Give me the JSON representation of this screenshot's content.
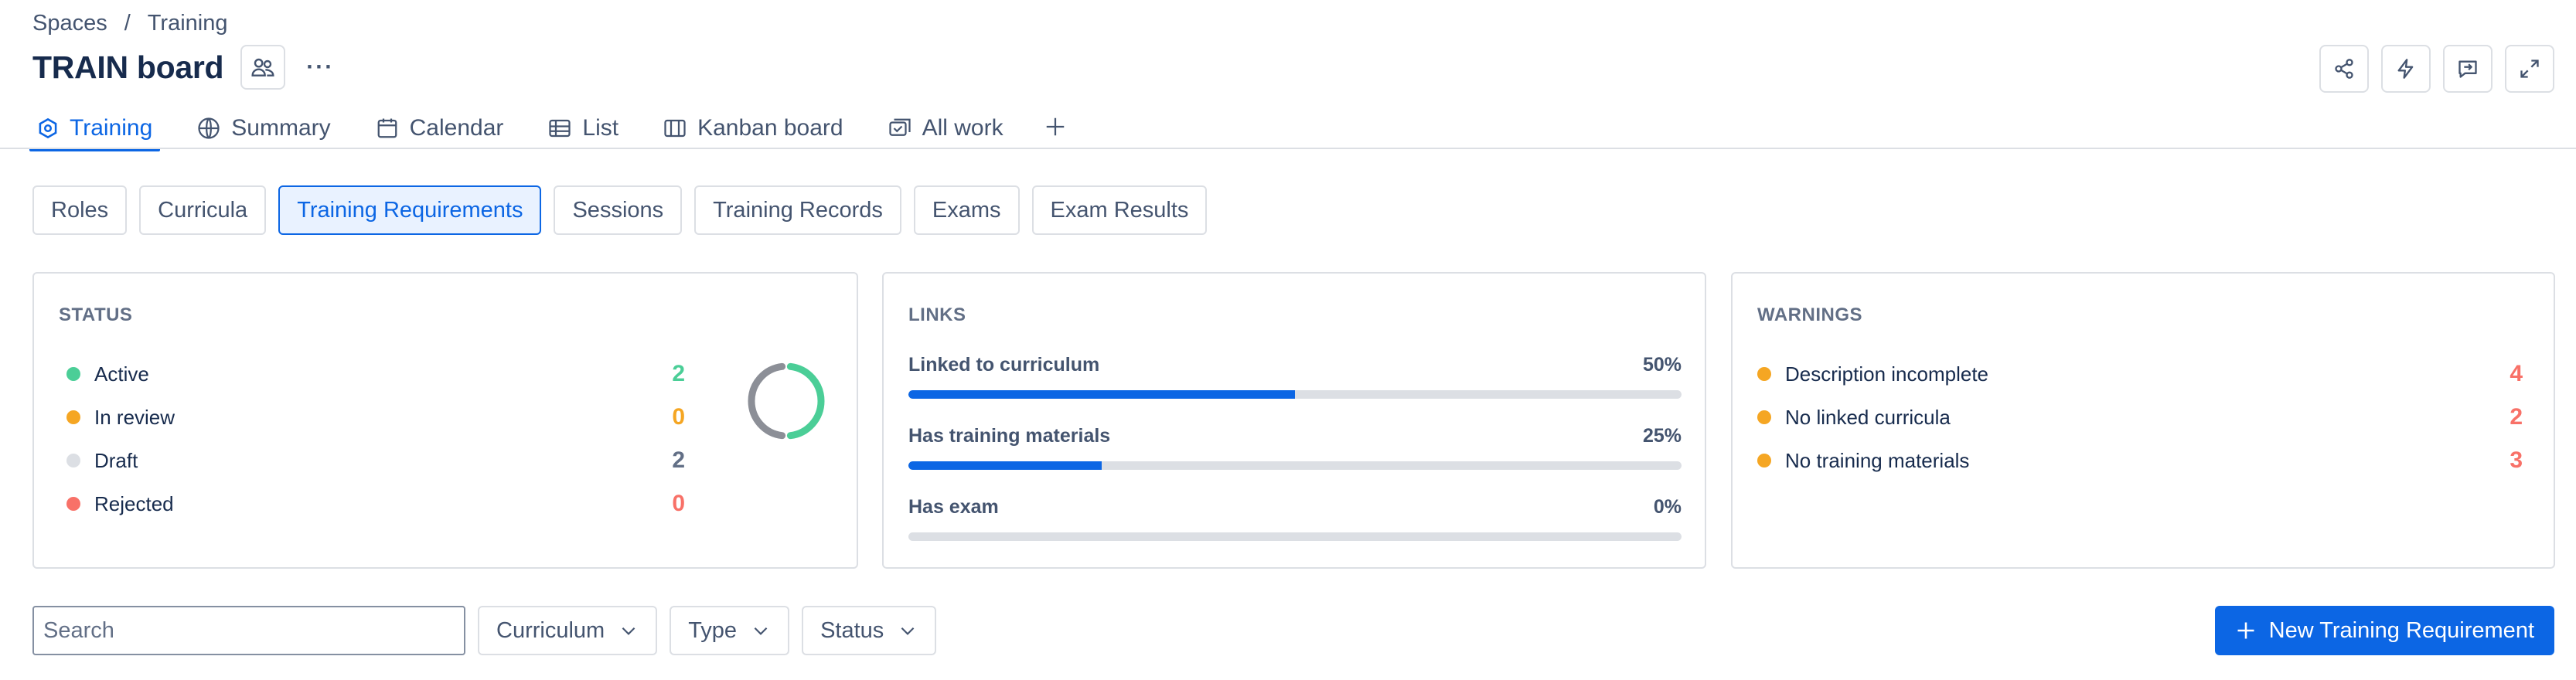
{
  "breadcrumb": {
    "root": "Spaces",
    "separator": "/",
    "current": "Training"
  },
  "header": {
    "title": "TRAIN board",
    "more": "···"
  },
  "tabs": [
    {
      "label": "Training",
      "icon": "training-hex-icon",
      "active": true
    },
    {
      "label": "Summary",
      "icon": "globe-icon"
    },
    {
      "label": "Calendar",
      "icon": "calendar-icon"
    },
    {
      "label": "List",
      "icon": "list-table-icon"
    },
    {
      "label": "Kanban board",
      "icon": "board-icon"
    },
    {
      "label": "All work",
      "icon": "all-work-icon"
    }
  ],
  "subnav": {
    "items": [
      "Roles",
      "Curricula",
      "Training Requirements",
      "Sessions",
      "Training Records",
      "Exams",
      "Exam Results"
    ],
    "active": "Training Requirements"
  },
  "status_card": {
    "title": "STATUS",
    "rows": [
      {
        "label": "Active",
        "count": "2",
        "color": "#4bce97"
      },
      {
        "label": "In review",
        "count": "0",
        "color": "#f5a623"
      },
      {
        "label": "Draft",
        "count": "2",
        "color": "#dcdfe4"
      },
      {
        "label": "Rejected",
        "count": "0",
        "color": "#f87168"
      }
    ],
    "count_colors": [
      "#4bce97",
      "#f5a623",
      "#626f86",
      "#f87168"
    ],
    "donut": {
      "active": 2,
      "draft": 2,
      "active_color": "#4bce97",
      "draft_color": "#8c8f97"
    }
  },
  "links_card": {
    "title": "LINKS",
    "items": [
      {
        "label": "Linked to curriculum",
        "percent": "50%",
        "value": 0.5
      },
      {
        "label": "Has training materials",
        "percent": "25%",
        "value": 0.25
      },
      {
        "label": "Has exam",
        "percent": "0%",
        "value": 0
      }
    ]
  },
  "warnings_card": {
    "title": "WARNINGS",
    "rows": [
      {
        "label": "Description incomplete",
        "count": "4"
      },
      {
        "label": "No linked curricula",
        "count": "2"
      },
      {
        "label": "No training materials",
        "count": "3"
      }
    ],
    "dot_color": "#f5a623",
    "count_color": "#f87168"
  },
  "filters": {
    "search_placeholder": "Search",
    "dropdowns": [
      "Curriculum",
      "Type",
      "Status"
    ]
  },
  "primary_action": {
    "label": "New Training Requirement"
  },
  "colors": {
    "accent": "#0c66e4",
    "border": "#dcdfe4",
    "text": "#172b4d",
    "subtle": "#44546f"
  }
}
